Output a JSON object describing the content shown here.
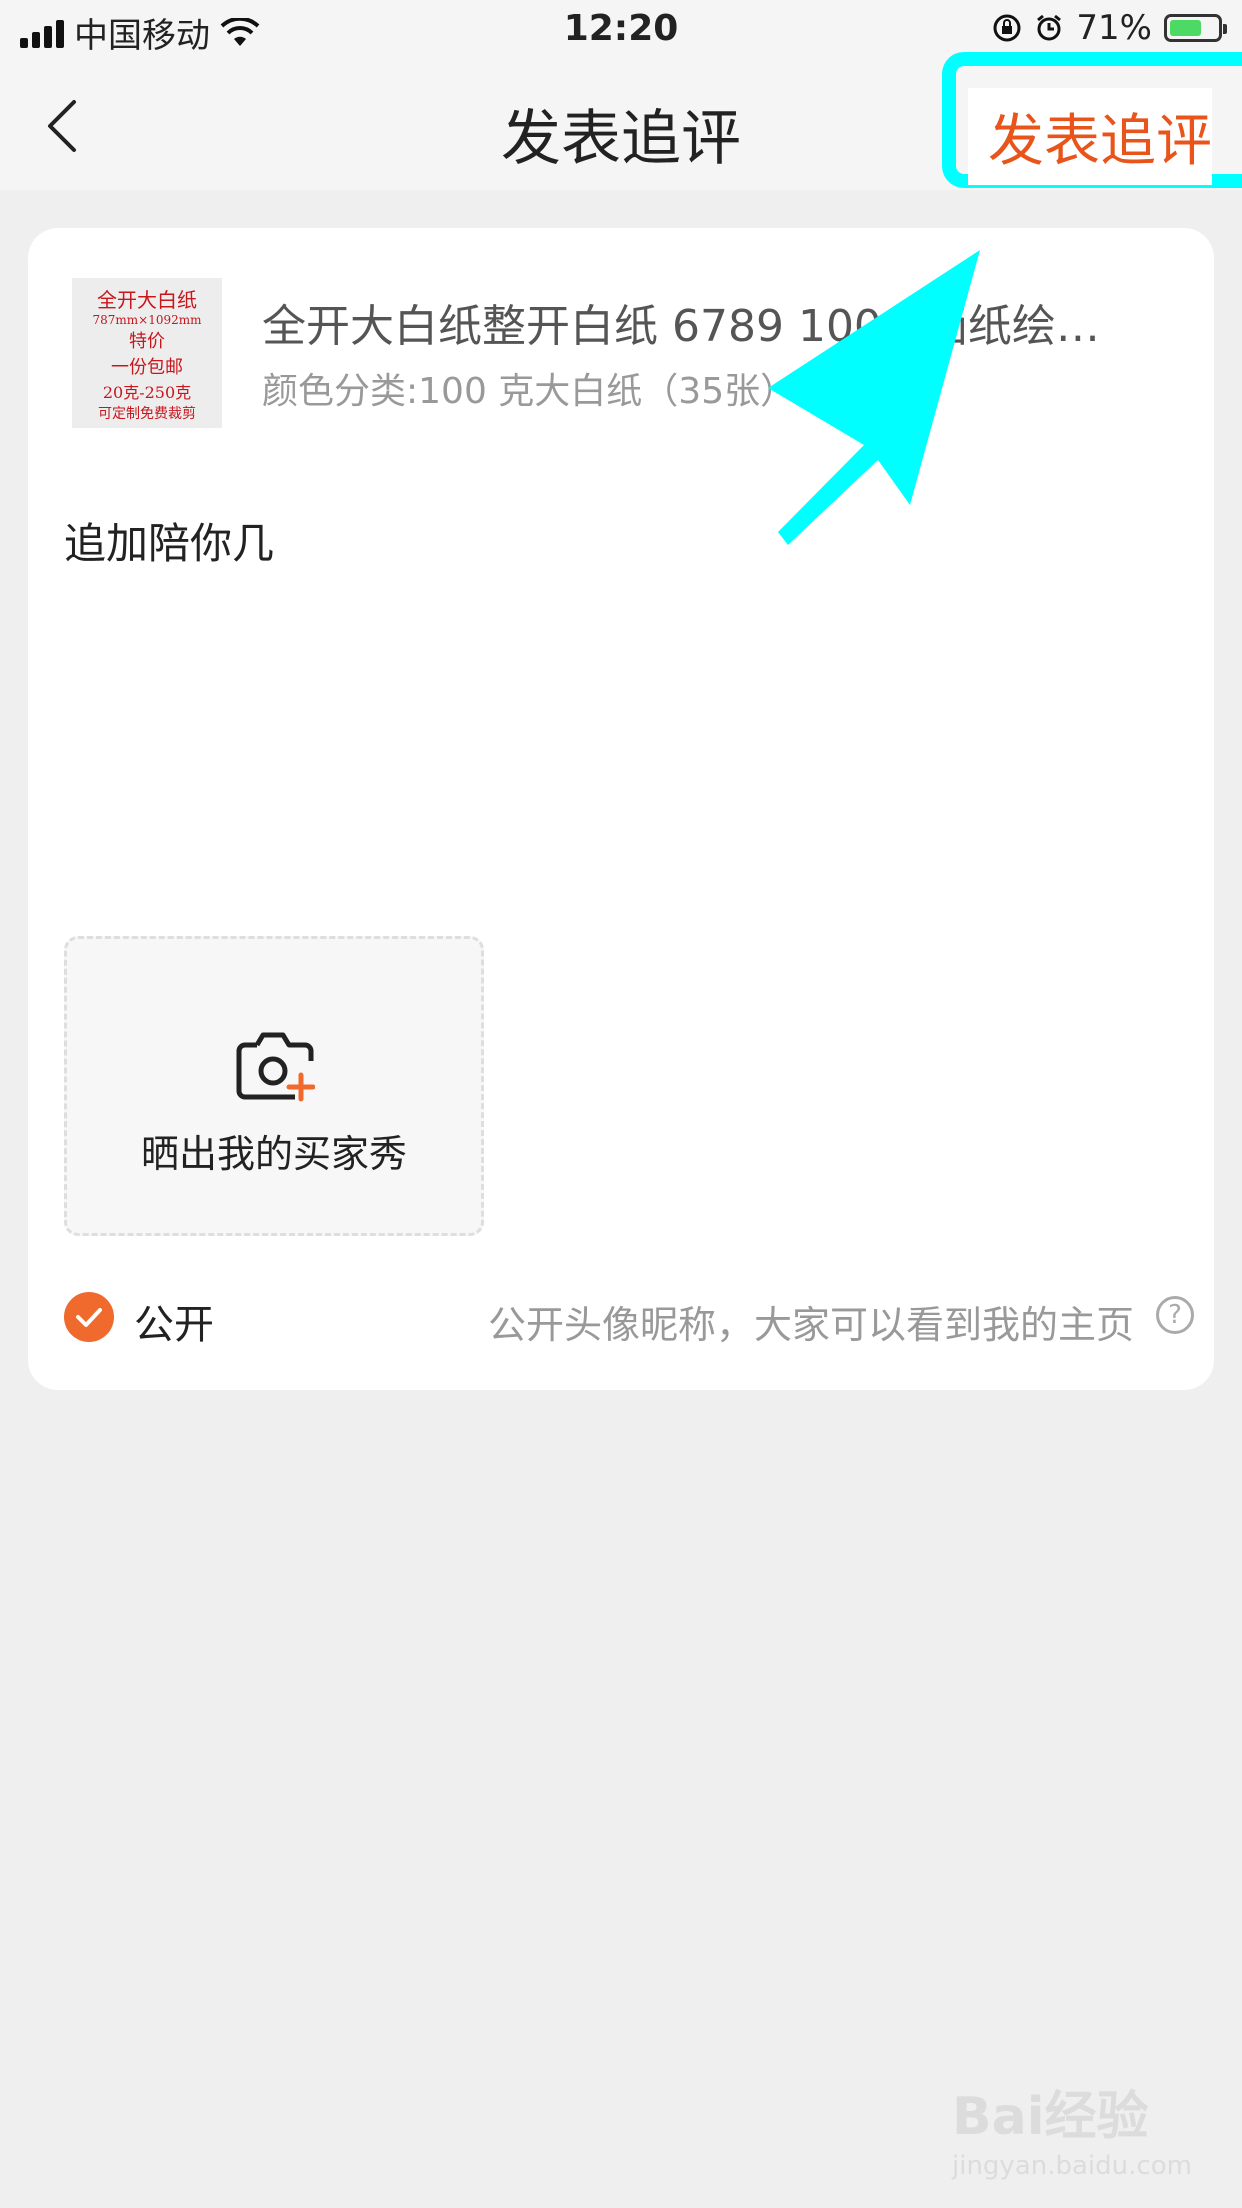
{
  "status_bar": {
    "carrier": "中国移动",
    "time": "12:20",
    "battery_percent": "71%",
    "battery_level": 0.71
  },
  "nav": {
    "title": "发表追评",
    "publish_label": "发表追评",
    "accent_color": "#e8541a"
  },
  "product": {
    "title": "全开大白纸整开白纸 6789 100g 画纸绘…",
    "sku": "颜色分类:100 克大白纸（35张）",
    "thumbnail_lines": [
      "全开大白纸",
      "787mm×1092mm",
      "特价",
      "一份包邮",
      "20克-250克",
      "可定制免费裁剪"
    ]
  },
  "review": {
    "comment_text": "追加陪你几"
  },
  "upload": {
    "label": "晒出我的买家秀",
    "icon": "camera-add-icon"
  },
  "public_option": {
    "checked": true,
    "label": "公开",
    "hint": "公开头像昵称，大家可以看到我的主页",
    "help_icon": "question-circle-icon"
  },
  "watermark": {
    "brand": "Bai经验",
    "url": "jingyan.baidu.com"
  }
}
